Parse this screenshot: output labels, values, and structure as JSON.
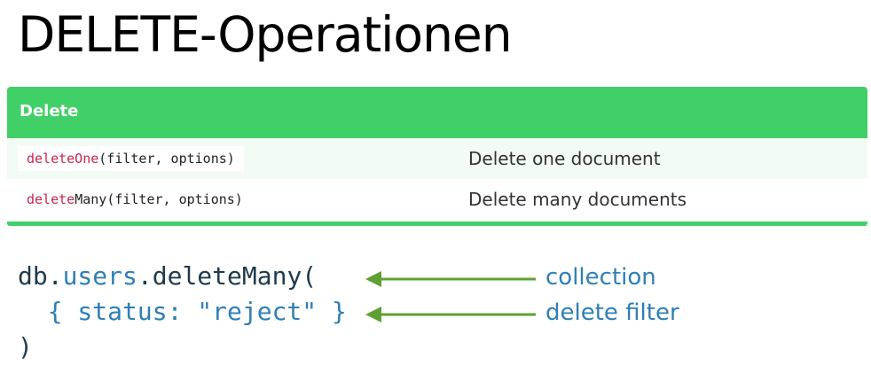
{
  "slide": {
    "title": "DELETE-Operationen"
  },
  "table": {
    "header": "Delete",
    "rows": [
      {
        "method_prefix": "deleteOne",
        "method_args": "(filter, options)",
        "description": "Delete one document"
      },
      {
        "method_prefix": "deleteMany",
        "method_args": "(filter, options)",
        "description": "Delete many documents"
      }
    ]
  },
  "code": {
    "line1_db": "db.",
    "line1_collection": "users",
    "line1_method": ".deleteMany(",
    "line2_filter": "  { status: \"reject\" }",
    "line3": ")"
  },
  "annotations": {
    "collection_label": "collection",
    "filter_label": "delete filter"
  },
  "colors": {
    "accent_green": "#41d068",
    "arrow_green": "#5fa033",
    "annotation_blue": "#2f7fb5",
    "code_red": "#c7254e"
  }
}
